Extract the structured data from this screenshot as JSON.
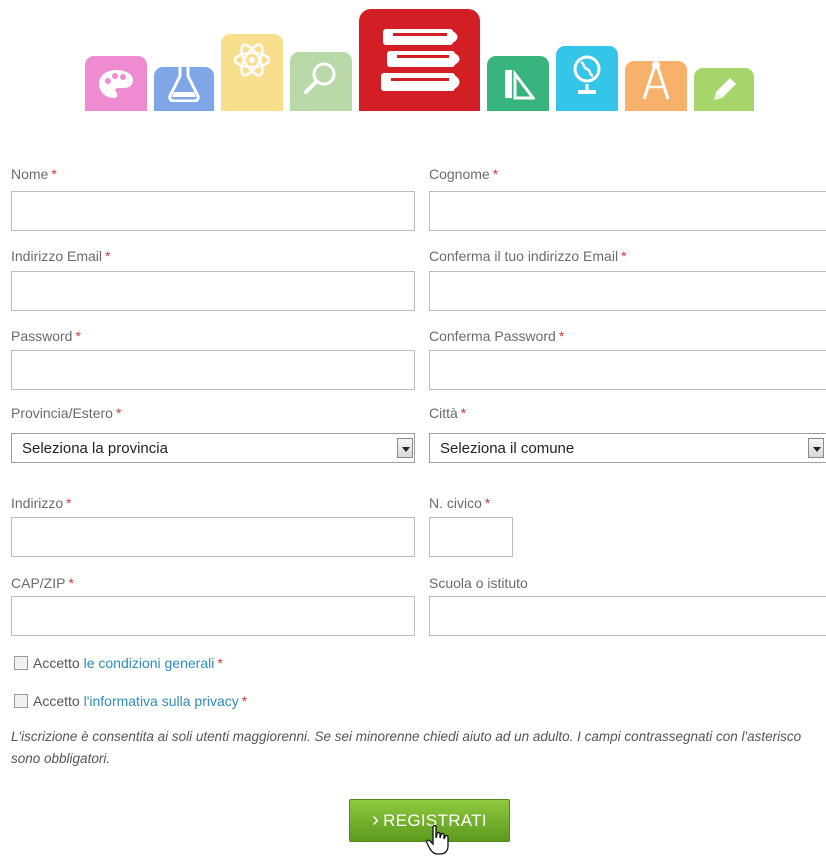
{
  "form": {
    "nome_label": "Nome",
    "cognome_label": "Cognome",
    "email_label": "Indirizzo Email",
    "conferma_email_label": "Conferma il tuo indirizzo Email",
    "password_label": "Password",
    "conferma_password_label": "Conferma Password",
    "provincia_label": "Provincia/Estero",
    "citta_label": "Città",
    "provincia_value": "Seleziona la provincia",
    "citta_value": "Seleziona il comune",
    "indirizzo_label": "Indirizzo",
    "civico_label": "N. civico",
    "cap_label": "CAP/ZIP",
    "scuola_label": "Scuola o istituto",
    "required_mark": "*"
  },
  "agreements": {
    "accetto": "Accetto",
    "condizioni_link": "le condizioni generali",
    "privacy_link": "l'informativa sulla privacy"
  },
  "notice": "L'iscrizione è consentita ai soli utenti maggiorenni. Se sei minorenne chiedi aiuto ad un adulto. I campi contrassegnati con l'asterisco sono obbligatori.",
  "submit_label": "REGISTRATI",
  "icons": [
    "palette-icon",
    "flask-icon",
    "atom-icon",
    "magnifier-icon",
    "books-icon",
    "ruler-triangle-icon",
    "globe-icon",
    "compass-icon",
    "pencil-icon"
  ],
  "colors": {
    "accent_red": "#d21f26",
    "button_green": "#6aab26",
    "link_blue": "#2e8bbf",
    "required_red": "#d03a3a"
  }
}
